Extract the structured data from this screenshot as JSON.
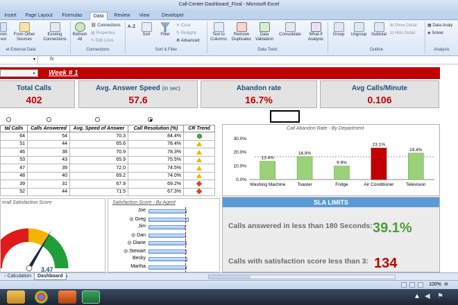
{
  "window": {
    "title": "Call-Center-Dashboard_Final - Microsoft Excel"
  },
  "tabs": [
    "Insert",
    "Page Layout",
    "Formulas",
    "Data",
    "Review",
    "View",
    "Developer"
  ],
  "active_tab": "Data",
  "ribbon": {
    "from_text": "rom\next",
    "from_other": "From Other\nSources",
    "existing": "Existing\nConnections",
    "refresh": "Refresh\nAll",
    "connections": "Connections",
    "properties": "Properties",
    "edit_links": "Edit Links",
    "sort_az": "A↓Z",
    "sort": "Sort",
    "filter": "Filter",
    "clear": "Clear",
    "reapply": "Reapply",
    "advanced": "Advanced",
    "text_to_columns": "Text to\nColumns",
    "remove_duplicates": "Remove\nDuplicates",
    "data_validation": "Data\nValidation",
    "consolidate": "Consolidate",
    "what_if": "What-If\nAnalysis",
    "group": "Group",
    "ungroup": "Ungroup",
    "subtotal": "Subtotal",
    "show_detail": "Show Detail",
    "hide_detail": "Hide Detail",
    "data_analysis": "Data Analy",
    "solver": "Solver",
    "groups": {
      "external": "et External Data",
      "connections": "Connections",
      "sort_filter": "Sort & Filter",
      "data_tools": "Data Tools",
      "outline": "Outline",
      "analysis": "Analysis"
    }
  },
  "week_label": "Week # 1",
  "kpis": [
    {
      "label": "Total Calls",
      "unit": "",
      "value": "402"
    },
    {
      "label": "Avg. Answer Speed",
      "unit": "(in sec)",
      "value": "57.6"
    },
    {
      "label": "Abandon rate",
      "unit": "",
      "value": "16.7%"
    },
    {
      "label": "Avg Calls/Minute",
      "unit": "",
      "value": "0.106"
    }
  ],
  "table": {
    "headers": [
      "tal Calls",
      "Calls Answered",
      "Avg. Speed of Answer",
      "Call Resolution (%)",
      "CR Trend"
    ],
    "rows": [
      [
        "64",
        "54",
        "70.3",
        "84.4%",
        "green"
      ],
      [
        "51",
        "44",
        "65.6",
        "78.4%",
        "yellow"
      ],
      [
        "46",
        "38",
        "70.9",
        "78.3%",
        "yellow"
      ],
      [
        "53",
        "43",
        "65.9",
        "75.5%",
        "yellow"
      ],
      [
        "47",
        "39",
        "72.0",
        "74.5%",
        "yellow"
      ],
      [
        "48",
        "40",
        "69.2",
        "74.0%",
        "yellow"
      ],
      [
        "39",
        "31",
        "67.9",
        "69.2%",
        "red"
      ],
      [
        "52",
        "44",
        "71.5",
        "67.3%",
        "red"
      ]
    ]
  },
  "chart_data": {
    "type": "bar",
    "title": "Call Abandon Rate - By Department",
    "categories": [
      "Washing Machine",
      "Toaster",
      "Fridge",
      "Air Conditioner",
      "Television"
    ],
    "values": [
      13.4,
      16.9,
      9.9,
      23.1,
      19.4
    ],
    "value_labels": [
      "13.4%",
      "16.9%",
      "9.9%",
      "23.1%",
      "19.4%"
    ],
    "ylim": [
      0,
      30
    ],
    "yticks": [
      "0.0%",
      "10.0%",
      "20.0%",
      "30.0%"
    ],
    "colors": {
      "normal": "#9bd17a",
      "highlight": "#c00000"
    },
    "average_line": 16.7
  },
  "gauge": {
    "title": "erall Satisfaction Score",
    "value_partial": "3.47"
  },
  "agents": {
    "title": "Satisfaction Score - By Agent",
    "names": [
      "Joe",
      "Greg",
      "Jim",
      "Dan",
      "Diane",
      "Stewart",
      "Becky",
      "Martha"
    ],
    "radio_on": [
      false,
      true,
      false,
      true,
      true,
      true,
      false,
      false
    ],
    "scores": [
      0.95,
      1.0,
      0.92,
      0.93,
      0.94,
      0.95,
      0.96,
      0.94
    ]
  },
  "sla": {
    "header": "SLA LIMITS",
    "line1": "Calls answered in less than 180 Seconds:",
    "value1": "39.1%",
    "line2": "Calls with satisfaction score less than 3:",
    "value2": "134",
    "color1": "#4e9a3a",
    "color2": "#c00000"
  },
  "sheets": [
    "Calculation",
    "Dashboard"
  ],
  "active_sheet": "Dashboard",
  "zoom": "100%"
}
